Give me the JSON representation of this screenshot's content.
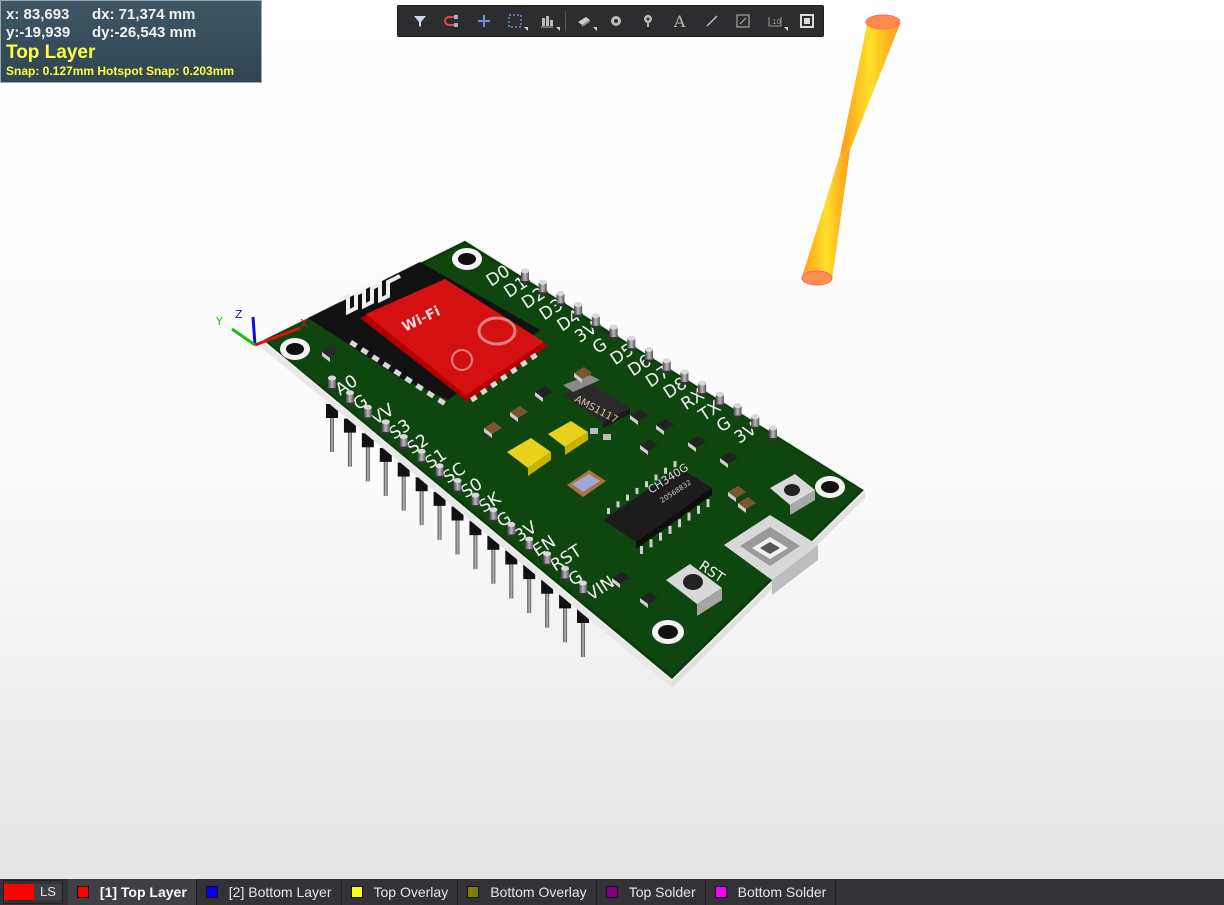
{
  "hud": {
    "x": "x: 83,693",
    "dx": "dx: 71,374 mm",
    "y": "y:-19,939",
    "dy": "dy:-26,543 mm",
    "layer": "Top Layer",
    "snap": "Snap: 0.127mm Hotspot Snap: 0.203mm"
  },
  "toolbar": {
    "items": [
      "filter-icon",
      "route-icon",
      "cross-icon",
      "select-rect-icon",
      "align-icon",
      "component-icon",
      "via-icon",
      "pad-icon",
      "text-icon",
      "line-icon",
      "dimension-icon",
      "room-icon",
      "region-icon"
    ]
  },
  "board": {
    "module_label": "Wi-Fi",
    "pins_right": [
      "D0",
      "D1",
      "D2",
      "D3",
      "D4",
      "3V",
      "G",
      "D5",
      "D6",
      "D7",
      "D8",
      "RX",
      "TX",
      "G",
      "3V"
    ],
    "pins_left": [
      "A0",
      "G",
      "VV",
      "S3",
      "S2",
      "S1",
      "SC",
      "S0",
      "SK",
      "G",
      "3V",
      "EN",
      "RST",
      "G",
      "VIN"
    ],
    "regulator": "AMS1117",
    "usb_chip": "CH340G",
    "usb_chip_code": "20568832",
    "button_label": "RST"
  },
  "axes": {
    "x": "X",
    "y": "Y",
    "z": "Z"
  },
  "statusbar": {
    "ls": "LS",
    "ls_color": "#ff0000",
    "layers": [
      {
        "label": "[1] Top Layer",
        "color": "#ff0000",
        "active": true
      },
      {
        "label": "[2] Bottom Layer",
        "color": "#0000ff",
        "active": false
      },
      {
        "label": "Top Overlay",
        "color": "#ffff00",
        "active": false
      },
      {
        "label": "Bottom Overlay",
        "color": "#808000",
        "active": false
      },
      {
        "label": "Top Solder",
        "color": "#800080",
        "active": false
      },
      {
        "label": "Bottom Solder",
        "color": "#ff00ff",
        "active": false
      }
    ]
  }
}
